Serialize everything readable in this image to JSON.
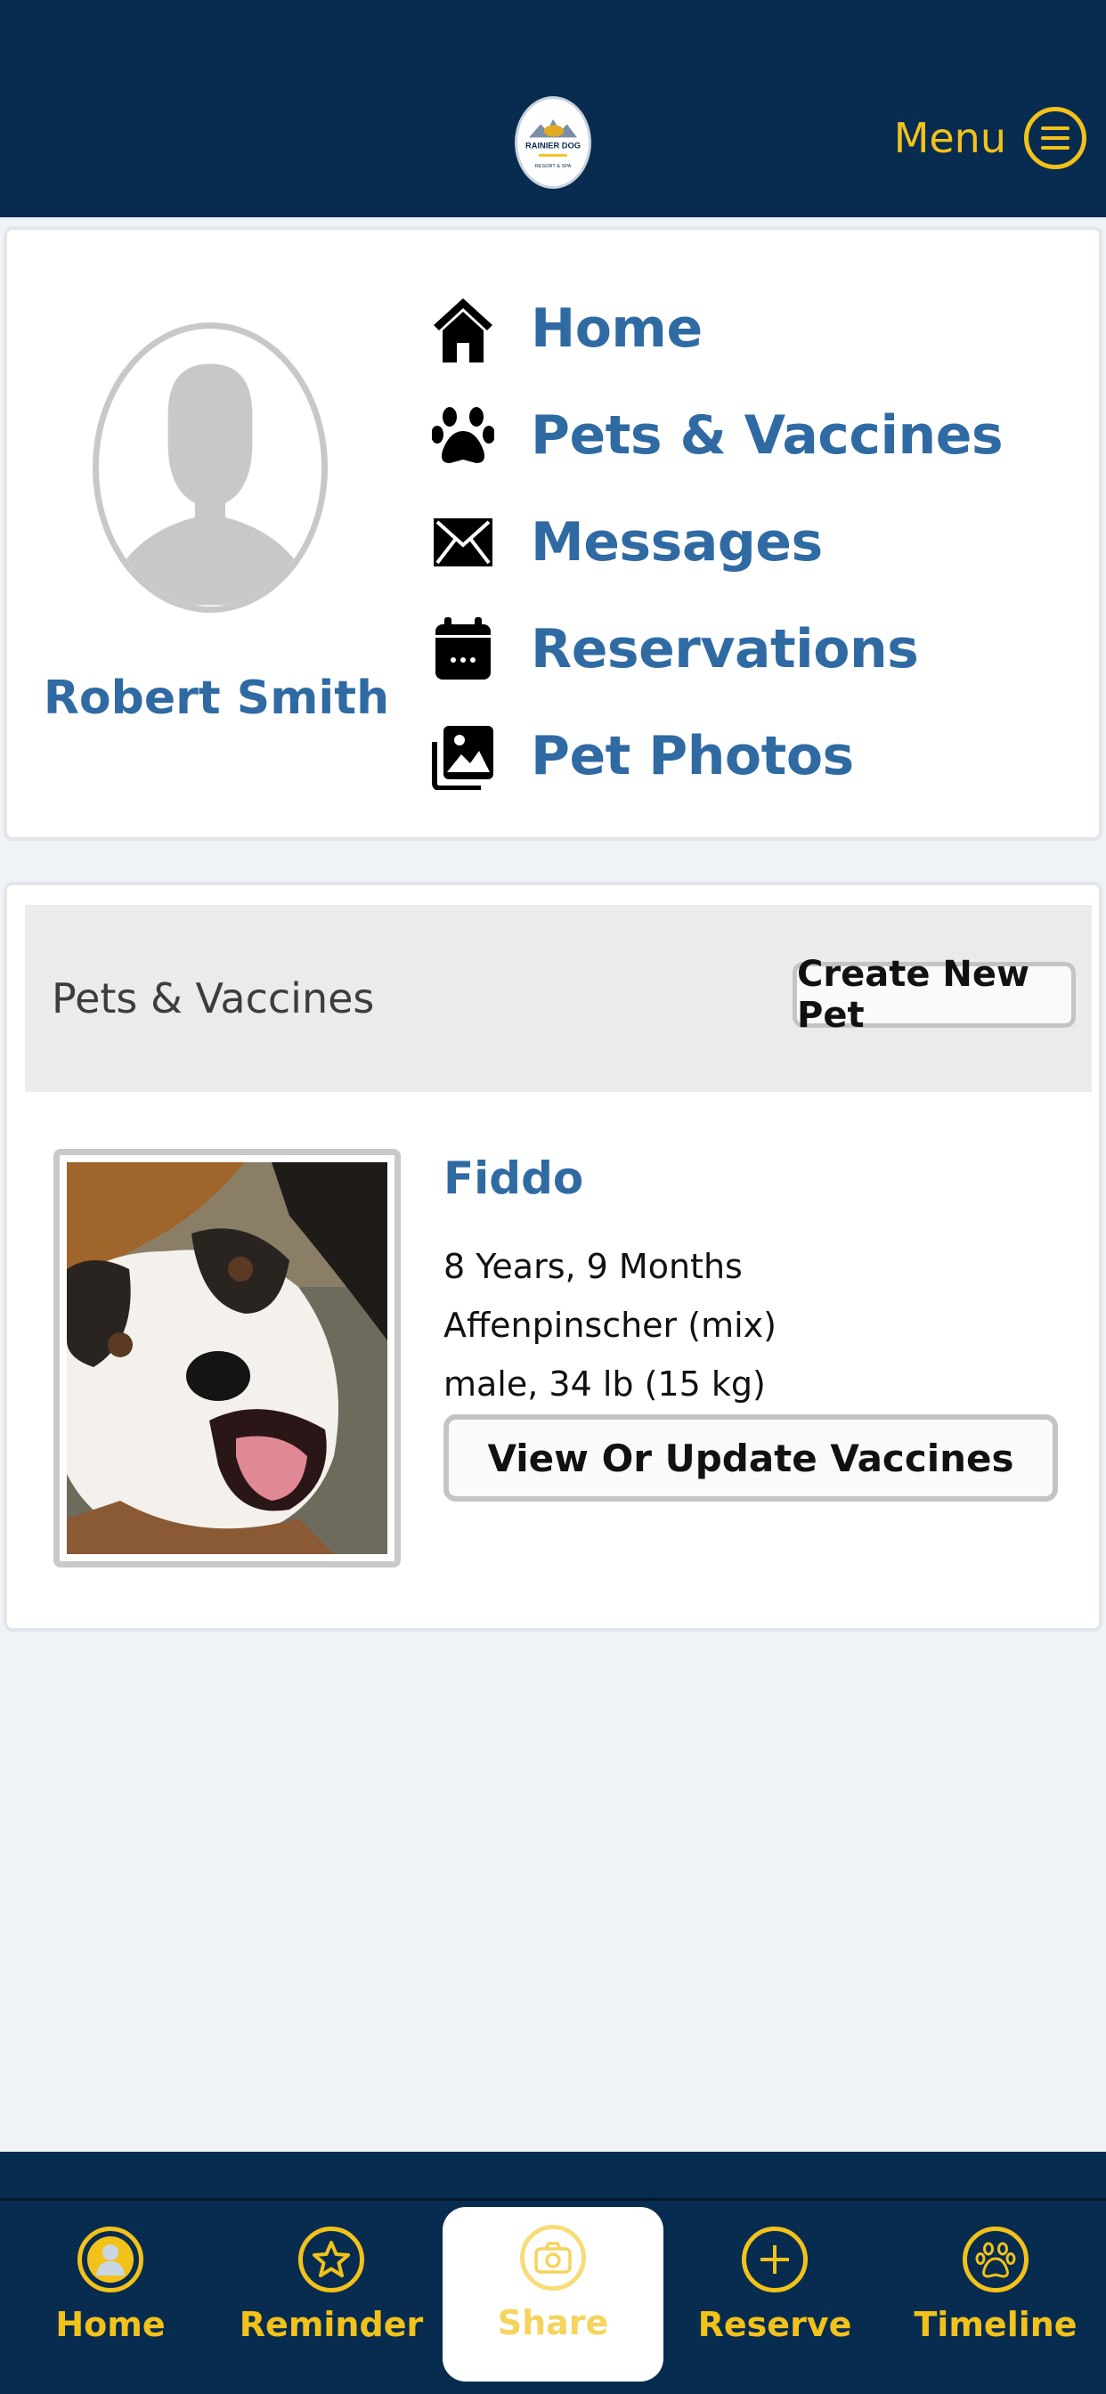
{
  "header": {
    "logo_text": "RAINIER DOG RESORT & SPA",
    "menu_label": "Menu"
  },
  "profile": {
    "name": "Robert Smith"
  },
  "nav": {
    "items": [
      {
        "label": "Home",
        "icon": "house-icon"
      },
      {
        "label": "Pets & Vaccines",
        "icon": "paw-icon"
      },
      {
        "label": "Messages",
        "icon": "envelope-icon"
      },
      {
        "label": "Reservations",
        "icon": "calendar-icon"
      },
      {
        "label": "Pet Photos",
        "icon": "photos-icon"
      }
    ]
  },
  "pets_section": {
    "title": "Pets & Vaccines",
    "create_button": "Create New Pet",
    "pets": [
      {
        "name": "Fiddo",
        "age": "8 Years, 9 Months",
        "breed": "Affenpinscher (mix)",
        "details": "male, 34 lb (15 kg)",
        "vaccines_button": "View Or Update Vaccines"
      }
    ]
  },
  "tabbar": {
    "tabs": [
      {
        "label": "Home",
        "icon": "user-icon"
      },
      {
        "label": "Reminder",
        "icon": "star-icon"
      },
      {
        "label": "Share",
        "icon": "camera-icon",
        "active": true
      },
      {
        "label": "Reserve",
        "icon": "plus-icon"
      },
      {
        "label": "Timeline",
        "icon": "paw-icon"
      }
    ]
  },
  "colors": {
    "navy": "#082c4f",
    "accent_yellow": "#f2c21b",
    "link_blue": "#2f6aa3"
  }
}
